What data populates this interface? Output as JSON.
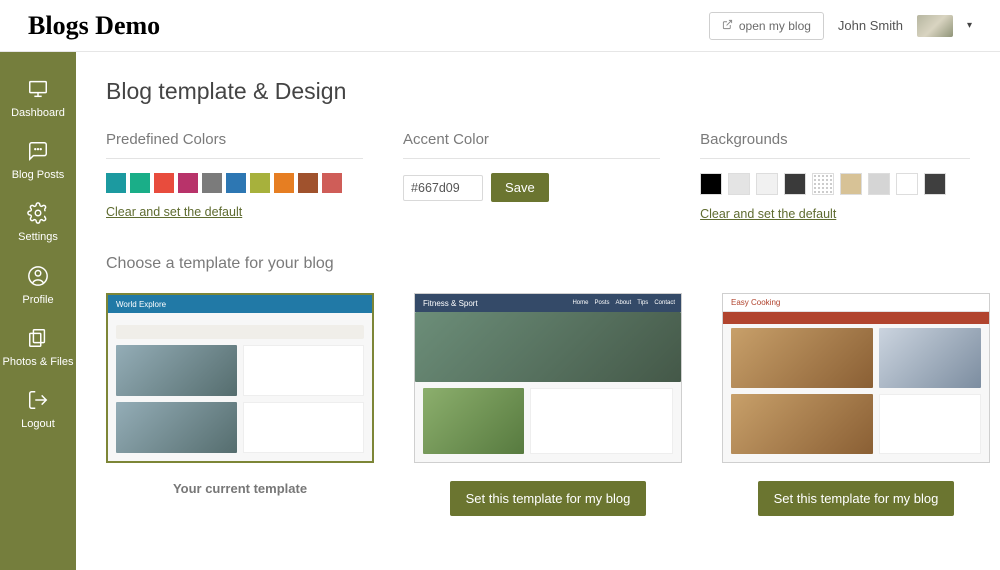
{
  "header": {
    "logo": "Blogs Demo",
    "open_blog_btn": "open my blog",
    "username": "John Smith"
  },
  "sidebar": {
    "items": [
      {
        "label": "Dashboard"
      },
      {
        "label": "Blog Posts"
      },
      {
        "label": "Settings"
      },
      {
        "label": "Profile"
      },
      {
        "label": "Photos & Files"
      },
      {
        "label": "Logout"
      }
    ]
  },
  "page": {
    "title": "Blog template & Design",
    "predefined": {
      "heading": "Predefined Colors",
      "clear": "Clear and set the default",
      "colors": [
        "#1c9aa0",
        "#1aae88",
        "#e84c3d",
        "#b8336a",
        "#7b7b7b",
        "#2d77b3",
        "#a7b13c",
        "#e67e22",
        "#a0522d",
        "#cf5d58"
      ]
    },
    "accent": {
      "heading": "Accent Color",
      "value": "#667d09",
      "save": "Save"
    },
    "backgrounds": {
      "heading": "Backgrounds",
      "clear": "Clear and set the default",
      "items": [
        {
          "bg": "#000000"
        },
        {
          "bg": "#e4e4e4"
        },
        {
          "bg": "#f1f1f1"
        },
        {
          "bg": "#3a3a3a"
        },
        {
          "bg": "#ffffff",
          "dots": true
        },
        {
          "bg": "#d7c296"
        },
        {
          "bg": "#d5d5d5"
        },
        {
          "bg": "#ffffff"
        },
        {
          "bg": "#3f3f3f"
        }
      ]
    },
    "templates": {
      "heading": "Choose a template for your blog",
      "current_label": "Your current template",
      "set_btn": "Set this template for my blog",
      "thumbs": [
        {
          "title": "World Explore"
        },
        {
          "title": "Fitness & Sport"
        },
        {
          "title": "Easy Cooking"
        }
      ]
    }
  }
}
